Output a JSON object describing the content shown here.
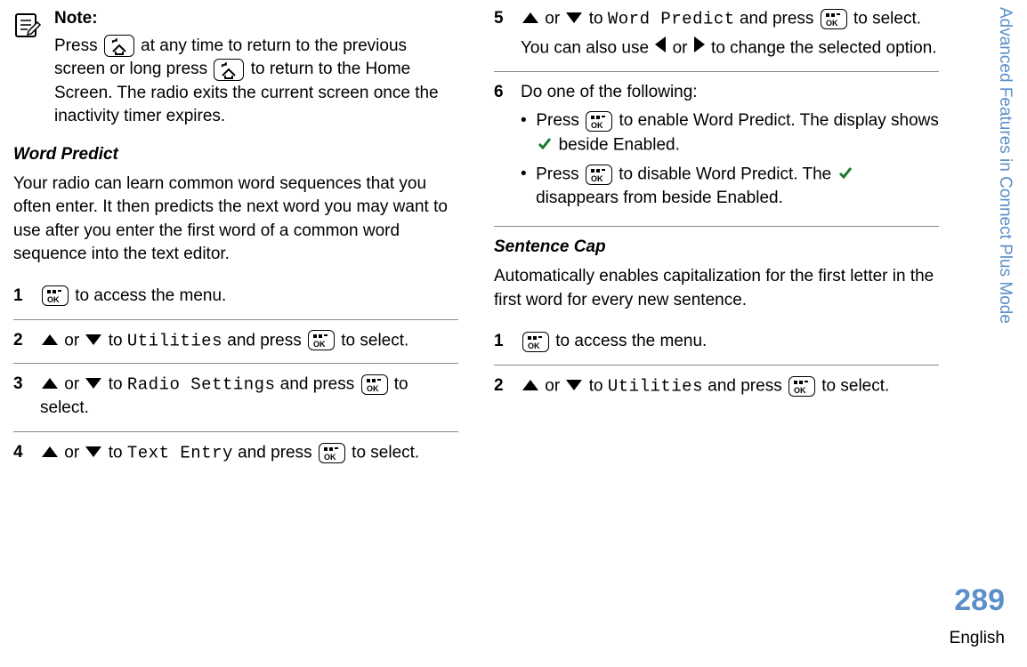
{
  "sidebar_title": "Advanced Features in Connect Plus Mode",
  "page_number": "289",
  "language": "English",
  "note": {
    "title": "Note:",
    "line1_a": "Press ",
    "line1_b": " at any time to return to the previous screen or long press ",
    "line1_c": " to return to the Home Screen. The radio exits the current screen once the inactivity timer expires."
  },
  "word_predict": {
    "heading": "Word Predict",
    "intro": "Your radio can learn common word sequences that you often enter. It then predicts the next word you may want to use after you enter the first word of a common word sequence into the text editor.",
    "step1": " to access the menu.",
    "step2_a": " or ",
    "step2_b": " to ",
    "step2_menu": "Utilities",
    "step2_c": " and press ",
    "step2_d": " to select.",
    "step3_a": " or ",
    "step3_b": " to ",
    "step3_menu": "Radio Settings",
    "step3_c": " and press ",
    "step3_d": " to select.",
    "step4_a": " or ",
    "step4_b": " to ",
    "step4_menu": "Text Entry",
    "step4_c": " and press ",
    "step4_d": " to select.",
    "step5_a": " or ",
    "step5_b": " to ",
    "step5_menu": "Word Predict",
    "step5_c": " and press ",
    "step5_d": " to select.",
    "step5_note_a": "You can also use ",
    "step5_note_b": " or ",
    "step5_note_c": " to change the selected option.",
    "step6_intro": "Do one of the following:",
    "step6_b1_a": "Press ",
    "step6_b1_b": " to enable Word Predict. The display shows ",
    "step6_b1_c": " beside Enabled.",
    "step6_b2_a": "Press ",
    "step6_b2_b": " to disable Word Predict. The ",
    "step6_b2_c": " disappears from beside Enabled."
  },
  "sentence_cap": {
    "heading": "Sentence Cap",
    "intro": "Automatically enables capitalization for the first letter in the first word for every new sentence.",
    "step1": " to access the menu.",
    "step2_a": " or ",
    "step2_b": " to ",
    "step2_menu": "Utilities",
    "step2_c": " and press ",
    "step2_d": " to select."
  },
  "nums": {
    "n1": "1",
    "n2": "2",
    "n3": "3",
    "n4": "4",
    "n5": "5",
    "n6": "6"
  }
}
